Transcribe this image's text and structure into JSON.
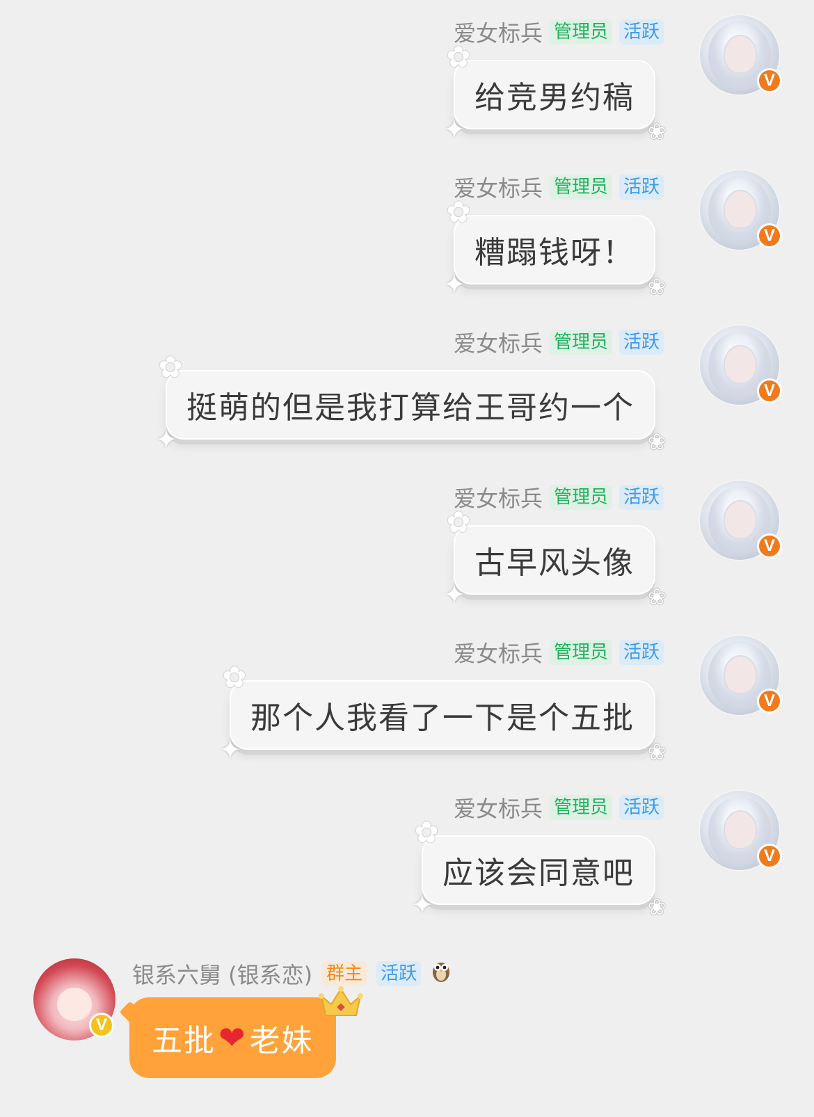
{
  "messages": [
    {
      "sender": "爱女标兵",
      "tags": [
        "管理员",
        "活跃"
      ],
      "text": "给竞男约稿",
      "badge": "V"
    },
    {
      "sender": "爱女标兵",
      "tags": [
        "管理员",
        "活跃"
      ],
      "text": "糟蹋钱呀！",
      "badge": "V"
    },
    {
      "sender": "爱女标兵",
      "tags": [
        "管理员",
        "活跃"
      ],
      "text": "挺萌的但是我打算给王哥约一个",
      "badge": "V"
    },
    {
      "sender": "爱女标兵",
      "tags": [
        "管理员",
        "活跃"
      ],
      "text": "古早风头像",
      "badge": "V"
    },
    {
      "sender": "爱女标兵",
      "tags": [
        "管理员",
        "活跃"
      ],
      "text": "那个人我看了一下是个五批",
      "badge": "V"
    },
    {
      "sender": "爱女标兵",
      "tags": [
        "管理员",
        "活跃"
      ],
      "text": "应该会同意吧",
      "badge": "V"
    }
  ],
  "last": {
    "sender": "银系六舅 (银系恋)",
    "tags": [
      "群主",
      "活跃"
    ],
    "badge": "V",
    "text_before": "五批",
    "heart": "❤",
    "text_after": "老妹",
    "owl_icon": "owl-icon",
    "crown_icon": "crown-icon"
  },
  "colors": {
    "background": "#efefef",
    "admin_tag": "#1fb35d",
    "active_tag": "#3b9be8",
    "owner_tag": "#f08a1c",
    "orange_bubble": "#ffa23a",
    "verify_badge": "#f07a1c"
  }
}
